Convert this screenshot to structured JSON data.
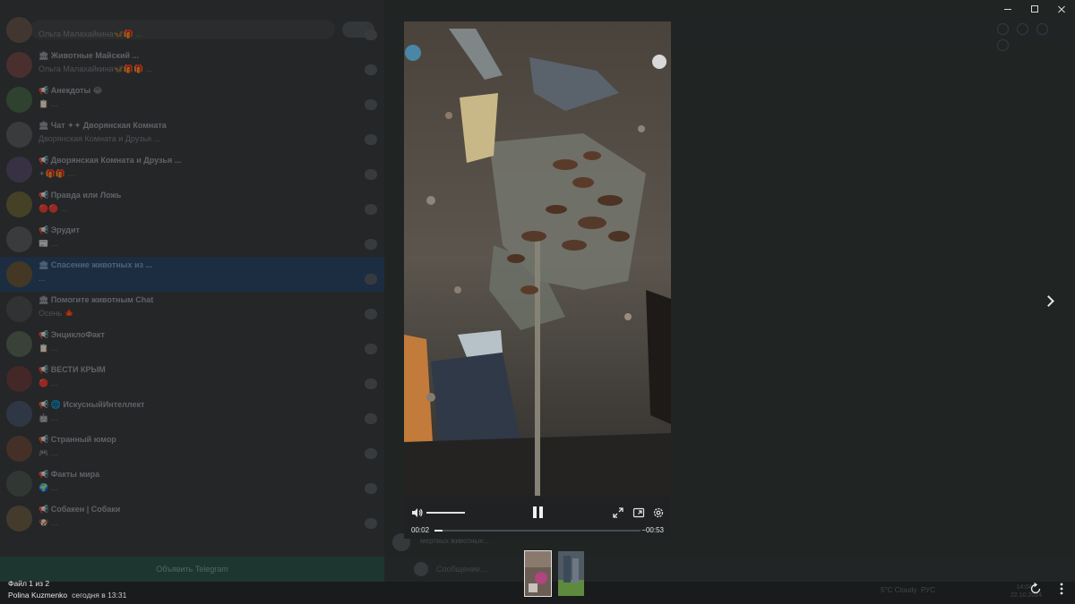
{
  "sidebar": {
    "chats": [
      {
        "title": "",
        "preview": "Ольга Малахайкина🦋🎁 ...",
        "time": "",
        "avatar_color": "#6b5a4e"
      },
      {
        "title": "🏛 Животные Майский ...",
        "preview": "Ольга Малахайкина🦋🎁🎁 ...",
        "time": "",
        "avatar_color": "#7a4b4b"
      },
      {
        "title": "📢 Анекдоты 😂",
        "preview": "📋 ...",
        "time": "",
        "avatar_color": "#4d6b4e"
      },
      {
        "title": "🏛 Чат ✦✦ Дворянская Комната",
        "preview": "Дворянская Комната и Друзья ...",
        "time": "",
        "avatar_color": "#5c5f62"
      },
      {
        "title": "📢 Дворянская Комната и Друзья ...",
        "preview": "✦🎁🎁 ...",
        "time": "",
        "avatar_color": "#5b4f6e"
      },
      {
        "title": "📢 Правда или Ложь",
        "preview": "🔴🔴 ...",
        "time": "",
        "avatar_color": "#6e6a3e"
      },
      {
        "title": "📢 Эрудит",
        "preview": "📰 ...",
        "time": "",
        "avatar_color": "#5e6063"
      },
      {
        "title": "🏛 Спасение животных из ...",
        "preview": "...",
        "time": "",
        "avatar_color": "#6e5b3a",
        "selected": true
      },
      {
        "title": "🏛 Помогите животным Chat",
        "preview": "Осень 🍁",
        "time": "",
        "avatar_color": "#4f5255"
      },
      {
        "title": "📢 ЭнциклоФакт",
        "preview": "📋 ...",
        "time": "",
        "avatar_color": "#5c6b5a"
      },
      {
        "title": "📢 ВЕСТИ КРЫМ",
        "preview": "🔴 ...",
        "time": "",
        "avatar_color": "#6e3f3f"
      },
      {
        "title": "📢 🌐 ИскусныйИнтеллект",
        "preview": "🤖 ...",
        "time": "",
        "avatar_color": "#4e5a6e"
      },
      {
        "title": "📢 Странный юмор",
        "preview": "🎮 ...",
        "time": "",
        "avatar_color": "#6e4e3f"
      },
      {
        "title": "📢 Факты мира",
        "preview": "🌍 ...",
        "time": "",
        "avatar_color": "#4f5a52"
      },
      {
        "title": "📢 Собакен | Собаки",
        "preview": "🐶 ...",
        "time": "",
        "avatar_color": "#6e5f4a"
      }
    ],
    "subscribe_label": "Объявить Telegram"
  },
  "main": {
    "message_preview": "мертвых животных... ",
    "composer_placeholder": "Сообщение..."
  },
  "tray": {
    "weather": "5°C Cloudy",
    "lang": "РУС",
    "time": "14:04",
    "date": "22.10.2024"
  },
  "viewer": {
    "video": {
      "time_current": "00:02",
      "time_remaining": "−00:53",
      "progress": 0.04,
      "volume": 1.0
    },
    "file_counter": "Файл 1 из 2",
    "sender_name": "Polina Kuzmenko",
    "sender_date": "сегодня в 13:31"
  },
  "colors": {
    "accent_selected": "#2e4a6a",
    "subscribe_bar": "#2f5a4e",
    "controls_bg": "#1f2123"
  },
  "icons": {
    "volume": "speaker-icon",
    "play_pause": "pause-icon",
    "fullscreen": "expand-icon",
    "pip": "picture-in-picture-icon",
    "settings": "gear-icon",
    "next": "chevron-right-icon",
    "rotate": "rotate-icon",
    "more": "more-vertical-icon"
  }
}
